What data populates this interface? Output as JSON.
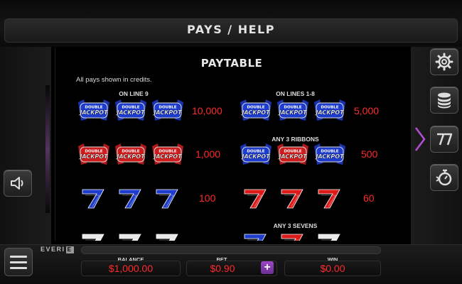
{
  "header": {
    "title": "PAYS / HELP"
  },
  "paytable": {
    "title": "PAYTABLE",
    "note": "All pays shown in credits.",
    "sections": {
      "left_top": "ON LINE 9",
      "right_top": "ON LINES 1-8",
      "right_ribbons": "ANY 3 RIBBONS",
      "right_sevens": "ANY 3 SEVENS"
    },
    "rows_left": [
      {
        "symbol": "double-jackpot-blue",
        "value": "10,000"
      },
      {
        "symbol": "double-jackpot-red",
        "value": "1,000"
      },
      {
        "symbol": "blue-seven",
        "value": "100"
      }
    ],
    "rows_right": [
      {
        "symbol": "double-jackpot-blue",
        "value": "5,000"
      },
      {
        "symbol": "mixed-jackpot",
        "value": "500"
      },
      {
        "symbol": "red-seven",
        "value": "60"
      }
    ],
    "symbol_text": {
      "double": "DOUBLE",
      "jackpot": "JACKPOT"
    }
  },
  "side_buttons": [
    {
      "name": "gear-icon"
    },
    {
      "name": "coins-icon"
    },
    {
      "name": "seven-icon"
    },
    {
      "name": "stopwatch-icon"
    }
  ],
  "left_buttons": [
    {
      "name": "speaker-icon"
    }
  ],
  "bottom": {
    "brand": "EVERI",
    "brand_mark": "E",
    "balance_label": "BALANCE",
    "balance_value": "$1,000.00",
    "bet_label": "BET",
    "bet_value": "$0.90",
    "plus_label": "+",
    "win_label": "WIN",
    "win_value": "$0.00"
  },
  "colors": {
    "accent": "#9b47c4",
    "value_red": "#ff2a2a",
    "blue_symbol": "#1e3ccc",
    "red_symbol": "#cc1e1e"
  }
}
